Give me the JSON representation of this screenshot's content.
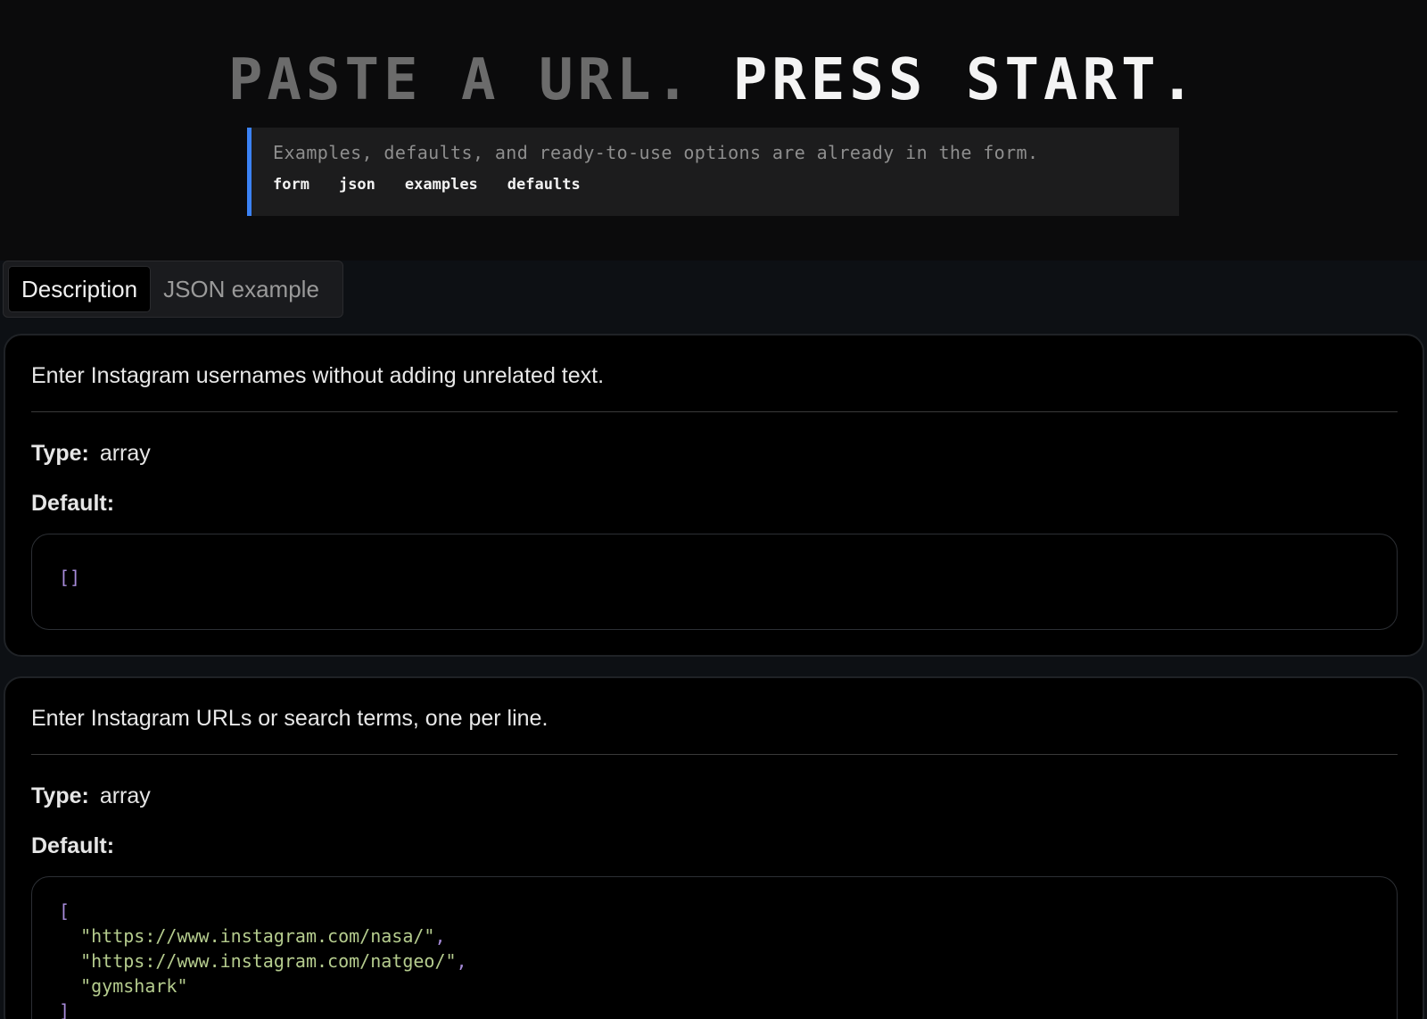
{
  "hero": {
    "title_part1": "PASTE A URL.",
    "title_part2": "PRESS START.",
    "subtitle": "Examples, defaults, and ready-to-use options are already in the form.",
    "chips": [
      "form",
      "json",
      "examples",
      "defaults"
    ]
  },
  "tabs": [
    {
      "label": "Description",
      "active": true
    },
    {
      "label": "JSON example",
      "active": false
    }
  ],
  "labels": {
    "type": "Type:",
    "default": "Default:"
  },
  "fields": [
    {
      "description": "Enter Instagram usernames without adding unrelated text.",
      "type": "array",
      "default_open": "[]",
      "default_items": [],
      "default_close": ""
    },
    {
      "description": "Enter Instagram URLs or search terms, one per line.",
      "type": "array",
      "default_open": "[",
      "default_items": [
        "\"https://www.instagram.com/nasa/\"",
        "\"https://www.instagram.com/natgeo/\"",
        "\"gymshark\""
      ],
      "default_close": "]"
    }
  ],
  "colors": {
    "accent": "#3b82f6",
    "string": "#b5cc8e",
    "punctuation": "#a78bda"
  }
}
